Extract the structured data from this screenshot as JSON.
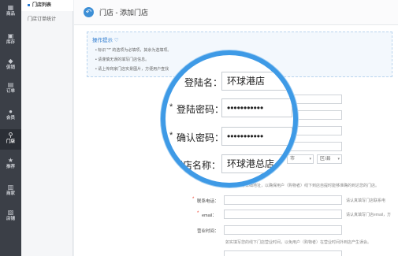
{
  "nav": {
    "items": [
      {
        "label": "商品",
        "icon": "grid-icon"
      },
      {
        "label": "库存",
        "icon": "box-icon"
      },
      {
        "label": "促销",
        "icon": "tag-icon"
      },
      {
        "label": "订单",
        "icon": "doc-icon"
      },
      {
        "label": "会员",
        "icon": "user-icon"
      },
      {
        "label": "门店",
        "icon": "location-icon"
      },
      {
        "label": "推荐",
        "icon": "star-icon"
      },
      {
        "label": "商家",
        "icon": "store-icon"
      },
      {
        "label": "店铺",
        "icon": "shop-icon"
      }
    ]
  },
  "subnav": {
    "items": [
      {
        "label": "门店列表"
      },
      {
        "label": "门店订单统计"
      }
    ]
  },
  "header": {
    "title": "门店 - 添加门店"
  },
  "tips": {
    "title": "操作提示",
    "lines": [
      "标识 \"*\" 的选项为必填项，其余为选填项。",
      "请谨慎无误的填写门店信息。",
      "请上传商家门店实景图片，方便用户查找"
    ]
  },
  "form": {
    "contact_phone_label": "联系电话：",
    "contact_phone_hint": "请认真填写门店联系电",
    "email_label": "email：",
    "email_hint": "请认真填写门店email，方",
    "hours_label": "营业时间：",
    "hours_hint": "如实填写您的线下门店营业时间，以免用户（购物者）在营业时间外到店产生误会。",
    "address_hint": "请认真填写详细地址，以确保用户（购物者）线下到店自提时能够准确的到达您的门店。",
    "city_select": "市",
    "district_select": "区/县"
  },
  "magnifier": {
    "login_name_label": "登陆名：",
    "login_name_value": "环球港店",
    "password_label": "登陆密码：",
    "password_value": "•••••••••••",
    "confirm_label": "确认密码：",
    "confirm_value": "•••••••••••",
    "store_name_label": "门店名称：",
    "store_name_value": "环球港总店"
  }
}
